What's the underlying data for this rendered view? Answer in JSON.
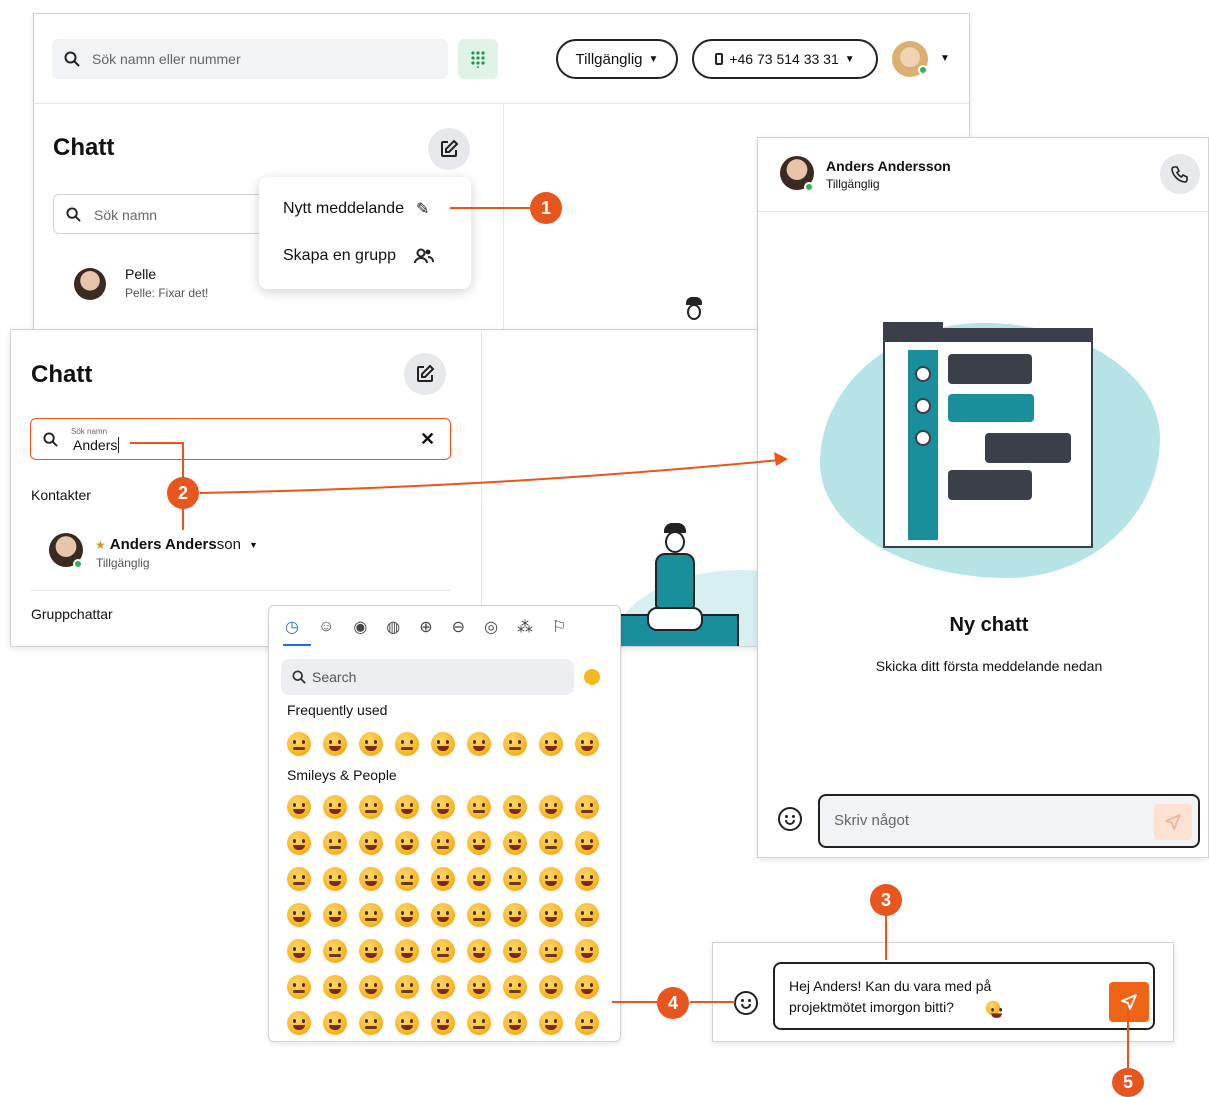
{
  "topbar": {
    "search_placeholder": "Sök namn eller nummer",
    "status_label": "Tillgänglig",
    "phone_label": "+46 73 514 33 31"
  },
  "chat1": {
    "title": "Chatt",
    "search_placeholder": "Sök namn",
    "contact_name": "Pelle",
    "contact_preview": "Pelle: Fixar det!"
  },
  "menu": {
    "new_message": "Nytt meddelande",
    "create_group": "Skapa en grupp"
  },
  "chat2": {
    "title": "Chatt",
    "search_floating_label": "Sök namn",
    "search_value": "Anders",
    "contacts_heading": "Kontakter",
    "contact_name_bold": "Anders Anders",
    "contact_name_rest": "son",
    "contact_status": "Tillgänglig",
    "groups_heading": "Gruppchattar"
  },
  "conversation": {
    "name": "Anders Andersson",
    "status": "Tillgänglig",
    "empty_title": "Ny chatt",
    "empty_subtitle": "Skicka ditt första meddelande nedan",
    "input_placeholder": "Skriv något"
  },
  "emoji_picker": {
    "search_placeholder": "Search",
    "frequently_used": "Frequently used",
    "smileys_people": "Smileys & People"
  },
  "composer": {
    "message_line1": "Hej Anders! Kan du vara med på",
    "message_line2": "projektmötet imorgon bitti?"
  },
  "callouts": [
    "1",
    "2",
    "3",
    "4",
    "5"
  ],
  "colors": {
    "accent": "#e8561d",
    "status_green": "#2fb35b",
    "teal": "#1a8f9c",
    "blob": "#b5e3e6"
  }
}
